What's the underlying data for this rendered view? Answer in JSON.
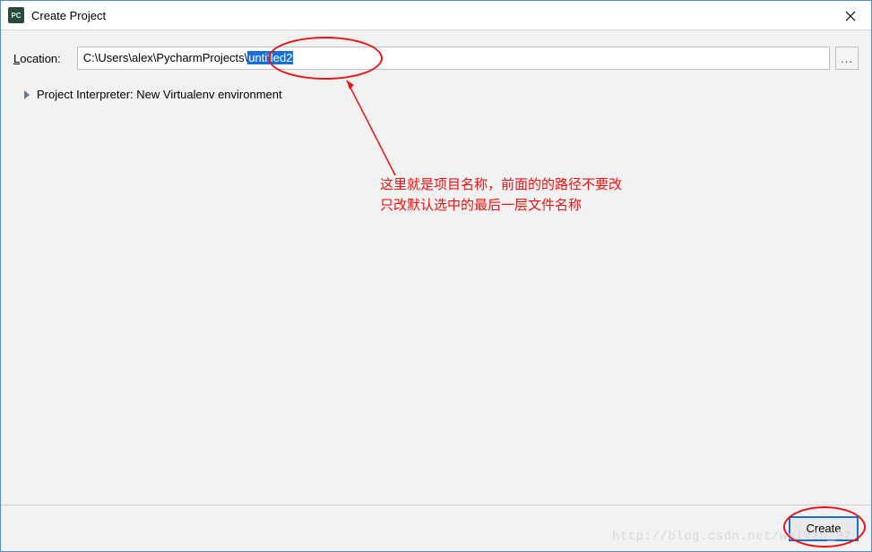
{
  "titlebar": {
    "app_icon_text": "PC",
    "title": "Create Project"
  },
  "form": {
    "location_label_prefix": "L",
    "location_label_rest": "ocation:",
    "location_path_prefix": "C:\\Users\\alex\\PycharmProjects\\",
    "location_path_selected": "untitled2",
    "browse_label": "..."
  },
  "expander": {
    "label": "Project Interpreter: New Virtualenv environment"
  },
  "annotation": {
    "line1": "这里就是项目名称，前面的的路径不要改",
    "line2": "只改默认选中的最后一层文件名称"
  },
  "footer": {
    "create_label": "Create"
  },
  "watermark": "http://blog.csdn.net/weixin_37"
}
